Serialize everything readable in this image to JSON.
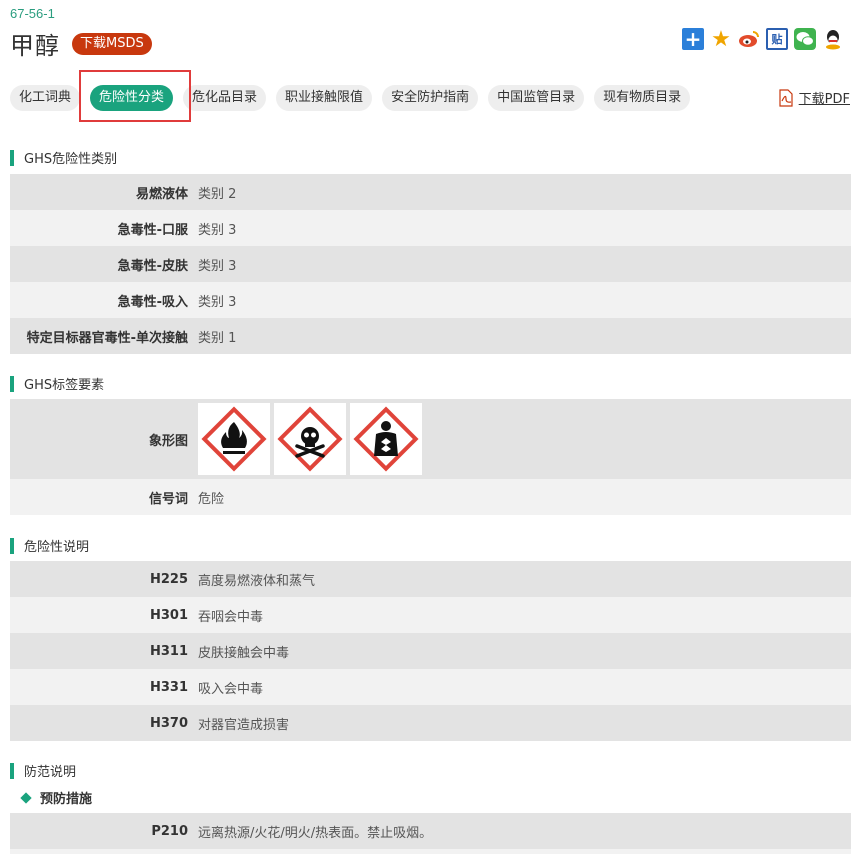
{
  "header": {
    "cas": "67-56-1",
    "title": "甲醇",
    "msds_label": "下载MSDS"
  },
  "share_icons": [
    "plus-icon",
    "star-icon",
    "weibo-icon",
    "tieba-icon",
    "wechat-icon",
    "qq-icon"
  ],
  "tabs": [
    {
      "label": "化工词典",
      "active": false
    },
    {
      "label": "危险性分类",
      "active": true
    },
    {
      "label": "危化品目录",
      "active": false
    },
    {
      "label": "职业接触限值",
      "active": false
    },
    {
      "label": "安全防护指南",
      "active": false
    },
    {
      "label": "中国监管目录",
      "active": false
    },
    {
      "label": "现有物质目录",
      "active": false
    }
  ],
  "pdf_label": "下载PDF",
  "ghs_class": {
    "title": "GHS危险性类别",
    "rows": [
      {
        "k": "易燃液体",
        "v": "类别 2"
      },
      {
        "k": "急毒性-口服",
        "v": "类别 3"
      },
      {
        "k": "急毒性-皮肤",
        "v": "类别 3"
      },
      {
        "k": "急毒性-吸入",
        "v": "类别 3"
      },
      {
        "k": "特定目标器官毒性-单次接触",
        "v": "类别 1"
      }
    ]
  },
  "ghs_label": {
    "title": "GHS标签要素",
    "pictogram_key": "象形图",
    "pictograms": [
      "flame-icon",
      "skull-crossbones-icon",
      "health-hazard-icon"
    ],
    "signal_key": "信号词",
    "signal_value": "危险"
  },
  "hazard": {
    "title": "危险性说明",
    "rows": [
      {
        "k": "H225",
        "v": "高度易燃液体和蒸气"
      },
      {
        "k": "H301",
        "v": "吞咽会中毒"
      },
      {
        "k": "H311",
        "v": "皮肤接触会中毒"
      },
      {
        "k": "H331",
        "v": "吸入会中毒"
      },
      {
        "k": "H370",
        "v": "对器官造成损害"
      }
    ]
  },
  "precaution": {
    "title": "防范说明",
    "sub": "预防措施",
    "rows": [
      {
        "k": "P210",
        "v": "远离热源/火花/明火/热表面。禁止吸烟。"
      }
    ]
  },
  "colors": {
    "accent": "#1aa37e",
    "msds": "#c8380e",
    "highlight": "#e03b3b",
    "ghs_red": "#e0443a"
  }
}
